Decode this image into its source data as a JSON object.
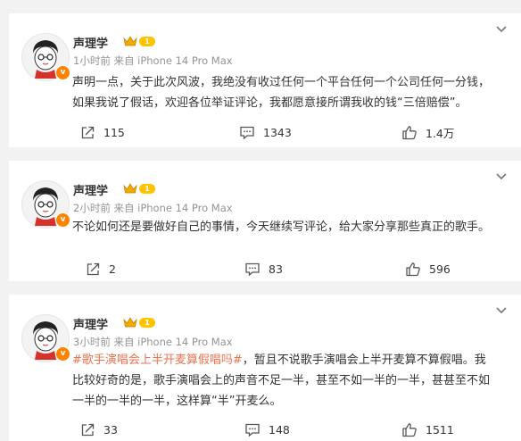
{
  "colors": {
    "topic": "#eb7350",
    "verified_badge": "#ff8200",
    "level_badge": "#ffc300",
    "meta": "#939393"
  },
  "posts": [
    {
      "author": "声理学",
      "level": "1",
      "time": "1小时前",
      "source": "来自 iPhone 14 Pro Max",
      "text_line1": "声明一点，关于此次风波，我绝没有收过任何一个平台任何一个公司任何一分钱，",
      "text_line2": "如果我说了假话，欢迎各位举证评论，我都愿意接所谓我收的钱“三倍赔偿”。",
      "reposts": "115",
      "comments": "1343",
      "likes": "1.4万"
    },
    {
      "author": "声理学",
      "level": "1",
      "time": "2小时前",
      "source": "来自 iPhone 14 Pro Max",
      "text_line1": "不论如何还是要做好自己的事情，今天继续写评论，给大家分享那些真正的歌手。",
      "reposts": "2",
      "comments": "83",
      "likes": "596"
    },
    {
      "author": "声理学",
      "level": "1",
      "time": "3小时前",
      "source": "来自 iPhone 14 Pro Max",
      "topic": "#歌手演唱会上半开麦算假唱吗#",
      "text_line1_rest": "，暂且不说歌手演唱会上半开麦算不算假唱。我",
      "text_line2": "比较好奇的是，歌手演唱会上的声音不足一半，甚至不如一半的一半，甚甚至不如",
      "text_line3": "一半的一半的一半，这样算“半”开麦么。",
      "reposts": "33",
      "comments": "148",
      "likes": "1511"
    }
  ]
}
